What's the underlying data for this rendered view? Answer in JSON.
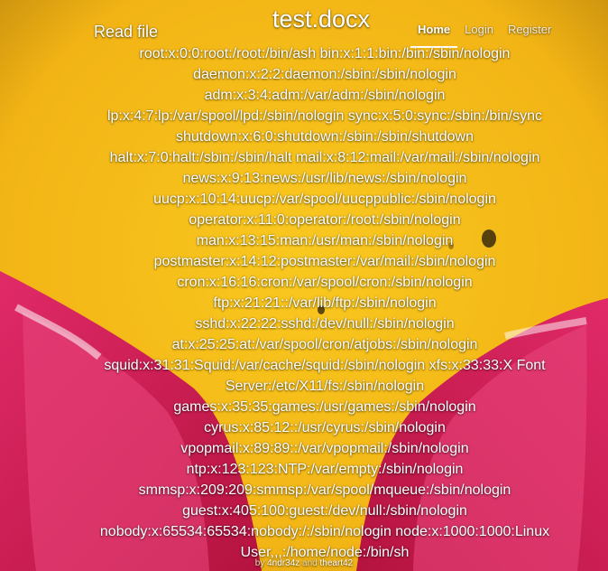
{
  "header": {
    "read_file": "Read file",
    "title": "test.docx"
  },
  "nav": {
    "home": "Home",
    "login": "Login",
    "register": "Register"
  },
  "content": {
    "lines": [
      "root:x:0:0:root:/root:/bin/ash bin:x:1:1:bin:/bin:/sbin/nologin",
      "daemon:x:2:2:daemon:/sbin:/sbin/nologin",
      "adm:x:3:4:adm:/var/adm:/sbin/nologin",
      "lp:x:4:7:lp:/var/spool/lpd:/sbin/nologin sync:x:5:0:sync:/sbin:/bin/sync",
      "shutdown:x:6:0:shutdown:/sbin:/sbin/shutdown",
      "halt:x:7:0:halt:/sbin:/sbin/halt mail:x:8:12:mail:/var/mail:/sbin/nologin",
      "news:x:9:13:news:/usr/lib/news:/sbin/nologin",
      "uucp:x:10:14:uucp:/var/spool/uucppublic:/sbin/nologin",
      "operator:x:11:0:operator:/root:/sbin/nologin",
      "man:x:13:15:man:/usr/man:/sbin/nologin",
      "postmaster:x:14:12:postmaster:/var/mail:/sbin/nologin",
      "cron:x:16:16:cron:/var/spool/cron:/sbin/nologin",
      "ftp:x:21:21::/var/lib/ftp:/sbin/nologin",
      "sshd:x:22:22:sshd:/dev/null:/sbin/nologin",
      "at:x:25:25:at:/var/spool/cron/atjobs:/sbin/nologin",
      "squid:x:31:31:Squid:/var/cache/squid:/sbin/nologin xfs:x:33:33:X Font",
      "Server:/etc/X11/fs:/sbin/nologin",
      "games:x:35:35:games:/usr/games:/sbin/nologin",
      "cyrus:x:85:12::/usr/cyrus:/sbin/nologin",
      "vpopmail:x:89:89::/var/vpopmail:/sbin/nologin",
      "ntp:x:123:123:NTP:/var/empty:/sbin/nologin",
      "smmsp:x:209:209:smmsp:/var/spool/mqueue:/sbin/nologin",
      "guest:x:405:100:guest:/dev/null:/sbin/nologin",
      "nobody:x:65534:65534:nobody:/:/sbin/nologin node:x:1000:1000:Linux",
      "User,,,:/home/node:/bin/sh"
    ]
  },
  "footer": {
    "by": "by",
    "author1": "4ndr34z",
    "and": "and",
    "author2": "theart42"
  },
  "colors": {
    "background": "#f7c21e",
    "ear": "#d81e5b",
    "text": "#ffffff"
  }
}
